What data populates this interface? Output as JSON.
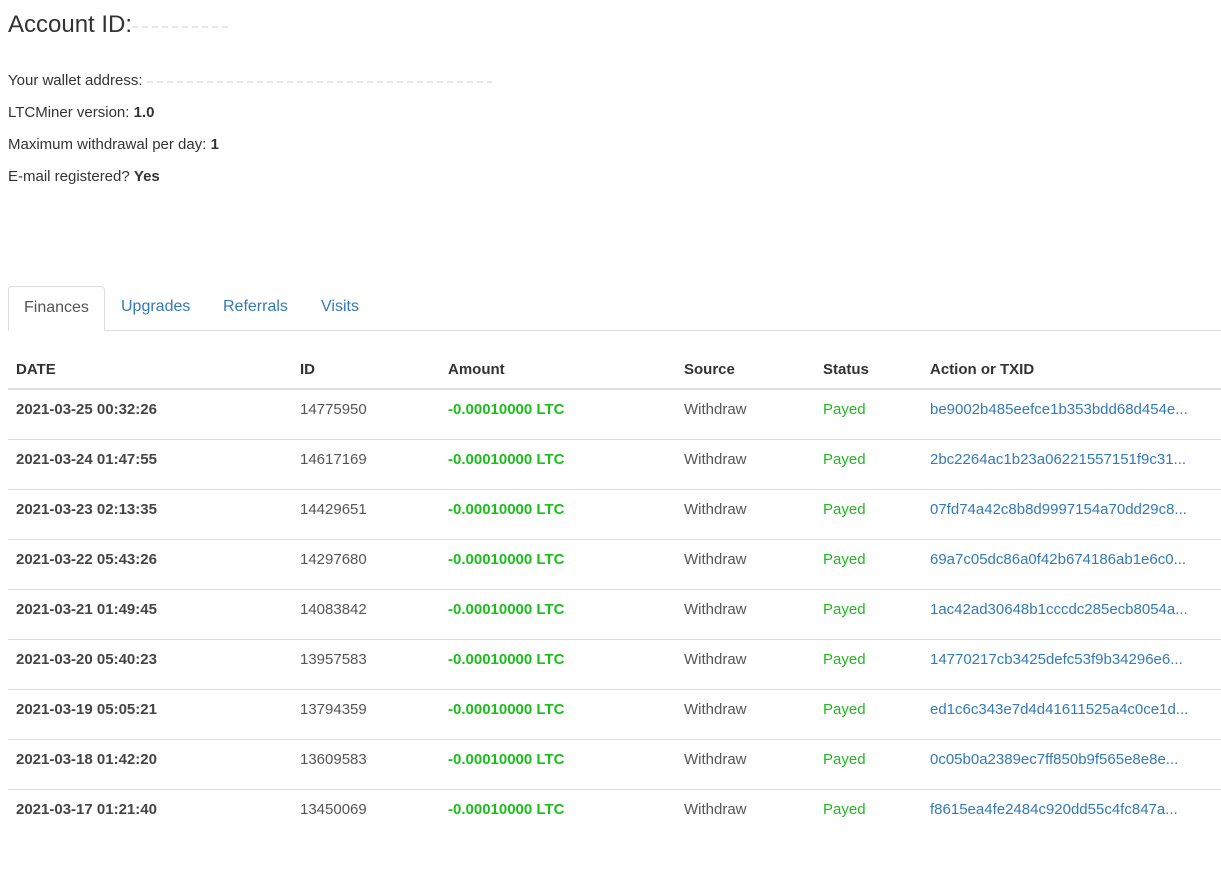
{
  "header": {
    "account_label": "Account ID:",
    "wallet_label": "Your wallet address: ",
    "version_label": "LTCMiner version: ",
    "version_value": "1.0",
    "max_withdrawal_label": "Maximum withdrawal per day: ",
    "max_withdrawal_value": "1",
    "email_label": "E-mail registered? ",
    "email_value": "Yes"
  },
  "tabs": [
    {
      "label": "Finances",
      "active": true
    },
    {
      "label": "Upgrades",
      "active": false
    },
    {
      "label": "Referrals",
      "active": false
    },
    {
      "label": "Visits",
      "active": false
    }
  ],
  "table": {
    "headers": [
      "DATE",
      "ID",
      "Amount",
      "Source",
      "Status",
      "Action or TXID"
    ],
    "rows": [
      {
        "date": "2021-03-25 00:32:26",
        "id": "14775950",
        "amount": "-0.00010000 LTC",
        "source": "Withdraw",
        "status": "Payed",
        "txid": "be9002b485eefce1b353bdd68d454e..."
      },
      {
        "date": "2021-03-24 01:47:55",
        "id": "14617169",
        "amount": "-0.00010000 LTC",
        "source": "Withdraw",
        "status": "Payed",
        "txid": "2bc2264ac1b23a06221557151f9c31..."
      },
      {
        "date": "2021-03-23 02:13:35",
        "id": "14429651",
        "amount": "-0.00010000 LTC",
        "source": "Withdraw",
        "status": "Payed",
        "txid": "07fd74a42c8b8d9997154a70dd29c8..."
      },
      {
        "date": "2021-03-22 05:43:26",
        "id": "14297680",
        "amount": "-0.00010000 LTC",
        "source": "Withdraw",
        "status": "Payed",
        "txid": "69a7c05dc86a0f42b674186ab1e6c0..."
      },
      {
        "date": "2021-03-21 01:49:45",
        "id": "14083842",
        "amount": "-0.00010000 LTC",
        "source": "Withdraw",
        "status": "Payed",
        "txid": "1ac42ad30648b1cccdc285ecb8054a..."
      },
      {
        "date": "2021-03-20 05:40:23",
        "id": "13957583",
        "amount": "-0.00010000 LTC",
        "source": "Withdraw",
        "status": "Payed",
        "txid": "14770217cb3425defc53f9b34296e6..."
      },
      {
        "date": "2021-03-19 05:05:21",
        "id": "13794359",
        "amount": "-0.00010000 LTC",
        "source": "Withdraw",
        "status": "Payed",
        "txid": "ed1c6c343e7d4d41611525a4c0ce1d..."
      },
      {
        "date": "2021-03-18 01:42:20",
        "id": "13609583",
        "amount": "-0.00010000 LTC",
        "source": "Withdraw",
        "status": "Payed",
        "txid": "0c05b0a2389ec7ff850b9f565e8e8e..."
      },
      {
        "date": "2021-03-17 01:21:40",
        "id": "13450069",
        "amount": "-0.00010000 LTC",
        "source": "Withdraw",
        "status": "Payed",
        "txid": "f8615ea4fe2484c920dd55c4fc847a..."
      }
    ]
  },
  "colors": {
    "link": "#337ab7",
    "amount_negative": "#1bbf1b",
    "status_payed": "#22b822",
    "text": "#333333",
    "border": "#dddddd"
  }
}
